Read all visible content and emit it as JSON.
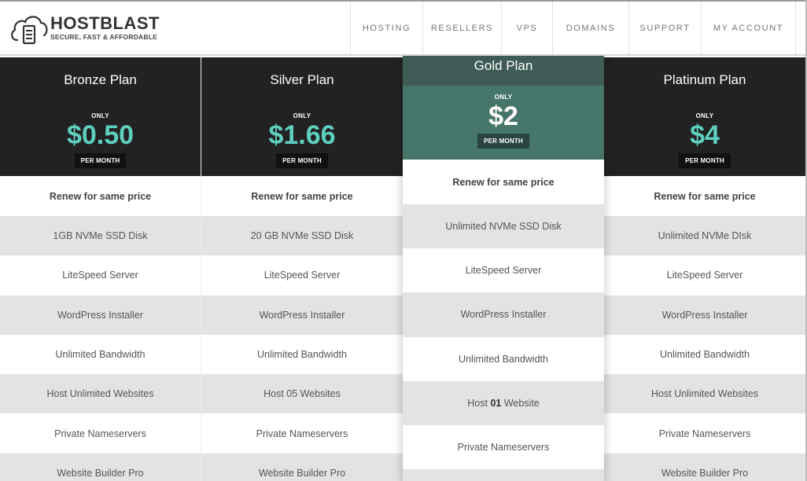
{
  "brand": {
    "name": "HOSTBLAST",
    "tagline": "SECURE, FAST & AFFORDABLE",
    "logo_icon": "cloud-server-icon"
  },
  "nav": {
    "items": [
      "HOSTING",
      "RESELLERS",
      "VPS",
      "DOMAINS",
      "SUPPORT",
      "MY ACCOUNT"
    ]
  },
  "plans": [
    {
      "title": "Bronze Plan",
      "only": "ONLY",
      "price": "$0.50",
      "period": "PER MONTH",
      "renew": "Renew for same price",
      "features": [
        "1GB  NVMe SSD Disk",
        "LiteSpeed Server",
        "WordPress Installer",
        "Unlimited Bandwidth",
        "Host Unlimited Websites",
        "Private Nameservers",
        "Website Builder Pro"
      ]
    },
    {
      "title": "Silver Plan",
      "only": "ONLY",
      "price": "$1.66",
      "period": "PER MONTH",
      "renew": "Renew for same price",
      "features": [
        "20 GB  NVMe SSD Disk",
        "LiteSpeed Server",
        "WordPress Installer",
        "Unlimited Bandwidth",
        "Host 05 Websites",
        "Private Nameservers",
        "Website Builder Pro"
      ]
    },
    {
      "title": "Gold Plan",
      "only": "ONLY",
      "price": "$2",
      "period": "PER MONTH",
      "renew": "Renew for same price",
      "features": [
        "Unlimited NVMe SSD Disk",
        "LiteSpeed Server",
        "WordPress Installer",
        "Unlimited Bandwidth",
        "Host ",
        "01",
        " Website",
        "Private Nameservers"
      ]
    },
    {
      "title": "Platinum Plan",
      "only": "ONLY",
      "price": "$4",
      "period": "PER MONTH",
      "renew": "Renew for same price",
      "features": [
        "Unlimited NVMe DIsk",
        "LiteSpeed Server",
        "WordPress Installer",
        "Unlimited Bandwidth",
        "Host Unlimited Websites",
        "Private Nameservers",
        "Website Builder Pro"
      ]
    }
  ],
  "colors": {
    "header_dark": "#222222",
    "price_accent": "#5ecfbf",
    "gold_title_bg": "#3e5c55",
    "gold_price_bg": "#467569",
    "stripe_gray": "#e2e3e5"
  }
}
